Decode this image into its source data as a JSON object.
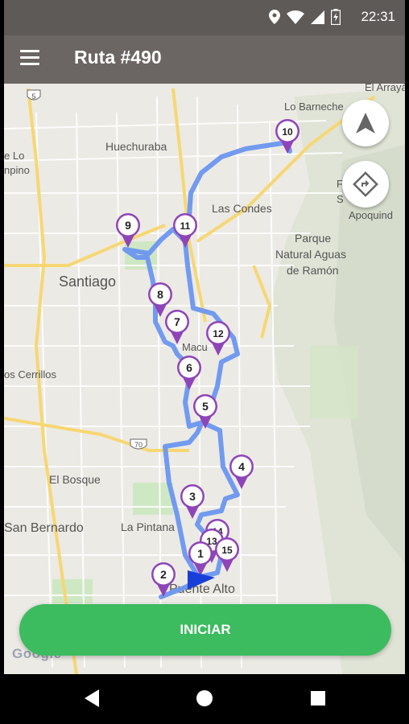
{
  "status_bar": {
    "time": "22:31",
    "icons": [
      "location-icon",
      "wifi-icon",
      "signal-icon",
      "battery-icon"
    ]
  },
  "app_bar": {
    "title": "Ruta #490",
    "menu_icon": "menu-icon"
  },
  "map": {
    "labels": {
      "el_arrayan": "El Arrayá",
      "lo_barnechea": "Lo Barneche",
      "huechuraba": "Huechuraba",
      "lo": "e Lo",
      "pino": "npino",
      "las_condes": "Las Condes",
      "parque_1": "Parque",
      "parque_2": "Natural Aguas",
      "parque_3": "de Ramón",
      "fa_1": "Fa",
      "fa_2": "S",
      "fa_3": "Apoquind",
      "santiago": "Santiago",
      "macul": "Macu",
      "cerrillos": "os Cerrillos",
      "el_bosque": "El Bosque",
      "san_bernardo": "San Bernardo",
      "la_pintana": "La Pintana",
      "puente_alto": "Puente Alto",
      "highway_5": "5",
      "highway_70": "70"
    },
    "stops": [
      "1",
      "2",
      "3",
      "4",
      "5",
      "6",
      "7",
      "8",
      "9",
      "10",
      "11",
      "12",
      "13",
      "14",
      "15"
    ],
    "route_color": "#6b96f0",
    "pin_color": "#8e45b8",
    "current_location_color": "#1a3fd9"
  },
  "buttons": {
    "navigate_icon": "navigation-arrow-icon",
    "directions_icon": "directions-icon",
    "start_label": "INICIAR",
    "start_color": "#3dbb5f"
  },
  "attribution": "Google",
  "nav_bar": {
    "back_icon": "back-icon",
    "home_icon": "home-icon",
    "recents_icon": "recents-icon"
  }
}
